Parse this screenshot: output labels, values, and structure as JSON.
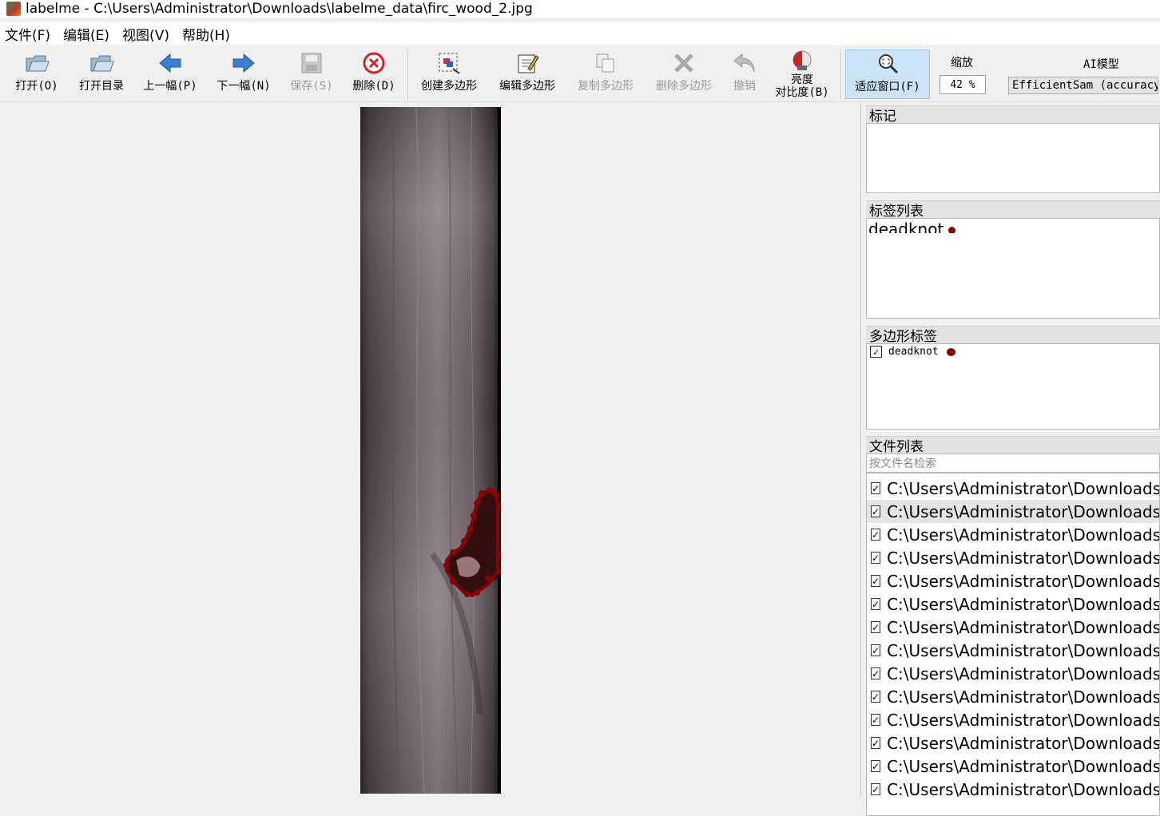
{
  "window": {
    "title": "labelme - C:\\Users\\Administrator\\Downloads\\labelme_data\\firc_wood_2.jpg"
  },
  "menu": [
    "文件(F)",
    "编辑(E)",
    "视图(V)",
    "帮助(H)"
  ],
  "toolbar": {
    "open": "打开(O)",
    "open_dir": "打开目录",
    "prev": "上一幅(P)",
    "next": "下一幅(N)",
    "save": "保存(S)",
    "delete": "删除(D)",
    "create_polygon": "创建多边形",
    "edit_polygon": "编辑多边形",
    "copy_polygon": "复制多边形",
    "delete_polygon": "删除多边形",
    "undo": "撤销",
    "brightness_line1": "亮度",
    "brightness_line2": "对比度(B)",
    "fit_window": "适应窗口(F)",
    "zoom_label": "缩放",
    "zoom_value": "42 %",
    "ai_label": "AI模型",
    "ai_model": "EfficientSam (accuracy)"
  },
  "colors": {
    "accent": "#8b0000",
    "fit_highlight": "#cce4f7"
  },
  "panels": {
    "flags_title": "标记",
    "labels_title": "标签列表",
    "labels": [
      {
        "name": "deadknot"
      }
    ],
    "polygons_title": "多边形标签",
    "polygons": [
      {
        "name": "deadknot",
        "checked": true
      }
    ],
    "files_title": "文件列表",
    "files_search_placeholder": "按文件名检索",
    "files": [
      "C:\\Users\\Administrator\\Downloads\\",
      "C:\\Users\\Administrator\\Downloads\\",
      "C:\\Users\\Administrator\\Downloads\\",
      "C:\\Users\\Administrator\\Downloads\\",
      "C:\\Users\\Administrator\\Downloads\\",
      "C:\\Users\\Administrator\\Downloads\\",
      "C:\\Users\\Administrator\\Downloads\\",
      "C:\\Users\\Administrator\\Downloads\\",
      "C:\\Users\\Administrator\\Downloads\\",
      "C:\\Users\\Administrator\\Downloads\\",
      "C:\\Users\\Administrator\\Downloads\\",
      "C:\\Users\\Administrator\\Downloads\\",
      "C:\\Users\\Administrator\\Downloads\\",
      "C:\\Users\\Administrator\\Downloads\\"
    ],
    "selected_file_index": 1
  }
}
